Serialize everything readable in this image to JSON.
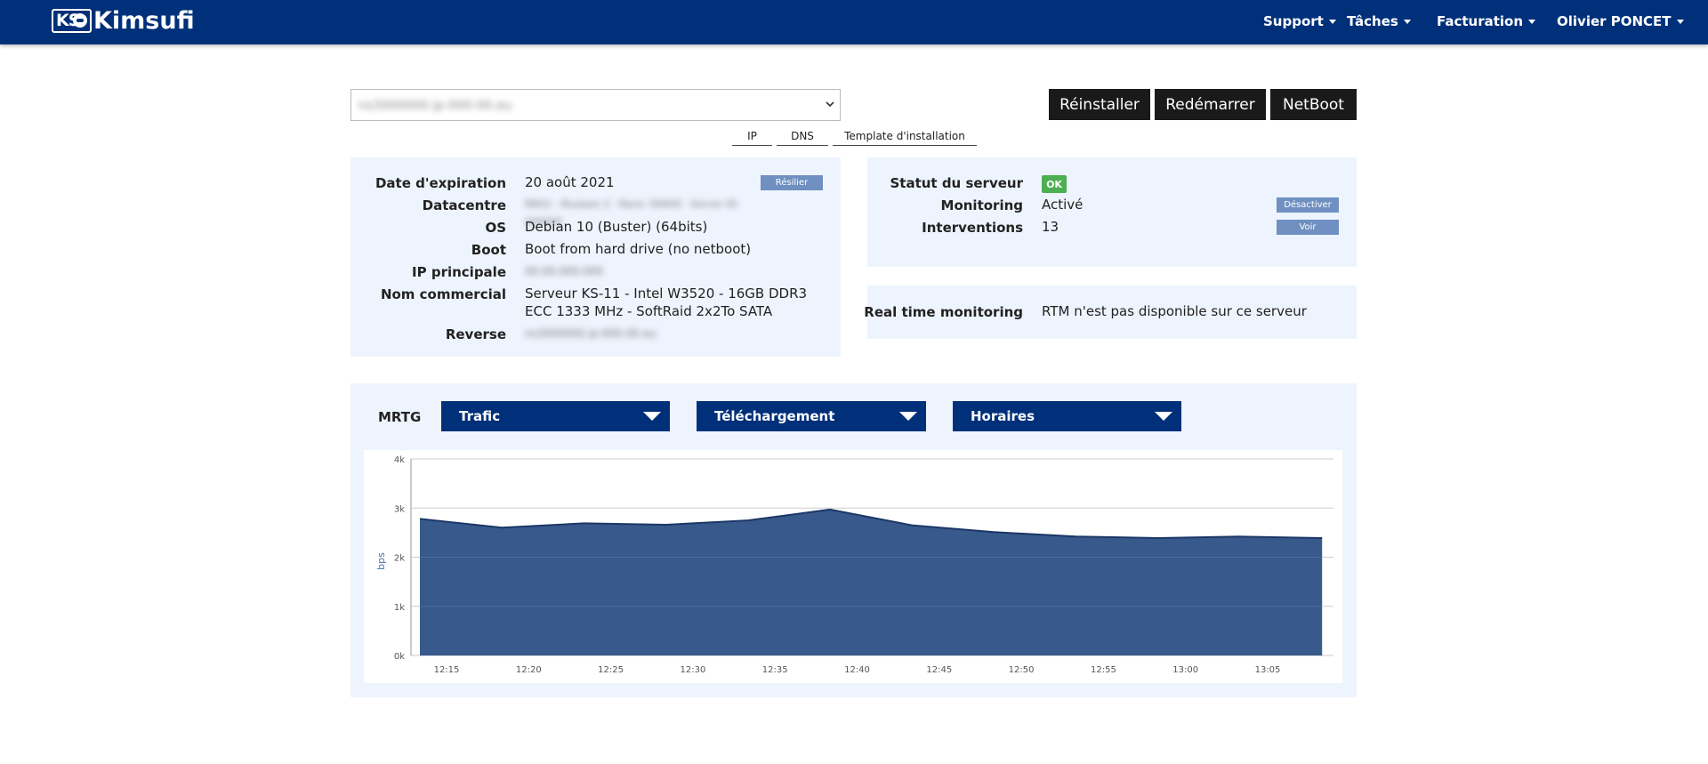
{
  "navbar": {
    "logo_mark": "KS",
    "logo_text": "Kimsufi",
    "menu": [
      {
        "label": "Support"
      },
      {
        "label": "Tâches"
      },
      {
        "label": "Facturation"
      },
      {
        "label": "Olivier PONCET"
      }
    ]
  },
  "server_select": {
    "value": "ns3000000.ip-000-00.eu",
    "chevron": "chevron-down-icon"
  },
  "actions": {
    "reinstall": "Réinstaller",
    "reboot": "Redémarrer",
    "netboot": "NetBoot"
  },
  "tabs": [
    "IP",
    "DNS",
    "Template d'installation"
  ],
  "details": {
    "expiration_label": "Date d'expiration",
    "expiration_value": "20 août 2021",
    "cancel_button": "Résilier",
    "datacenter_label": "Datacentre",
    "datacenter_value": "RBX2 - Roubaix 2 - Rack: 00A00 - Server ID: 000000",
    "os_label": "OS",
    "os_value": "Debian 10 (Buster) (64bits)",
    "boot_label": "Boot",
    "boot_value": "Boot from hard drive (no netboot)",
    "ip_label": "IP principale",
    "ip_value": "00.00.000.000",
    "name_label": "Nom commercial",
    "name_value": "Serveur KS-11 - Intel W3520 - 16GB DDR3 ECC 1333 MHz - SoftRaid 2x2To SATA",
    "reverse_label": "Reverse",
    "reverse_value": "ns3000000.ip-000-00.eu"
  },
  "status": {
    "server_status_label": "Statut du serveur",
    "server_status_value": "OK",
    "monitoring_label": "Monitoring",
    "monitoring_value": "Activé",
    "monitoring_button": "Désactiver",
    "interventions_label": "Interventions",
    "interventions_value": "13",
    "interventions_button": "Voir"
  },
  "rtm": {
    "label": "Real time monitoring",
    "value": "RTM n'est pas disponible sur ce serveur"
  },
  "mrtg": {
    "label": "MRTG",
    "dropdowns": [
      "Trafic",
      "Téléchargement",
      "Horaires"
    ]
  },
  "colors": {
    "navbar": "#00307a",
    "panel": "#eef4fd",
    "area": "#38598c",
    "ok": "#4caf50"
  },
  "chart_data": {
    "type": "area",
    "x": [
      "12:13",
      "12:18",
      "12:23",
      "12:28",
      "12:33",
      "12:38",
      "12:43",
      "12:48",
      "12:53",
      "12:58",
      "13:03",
      "13:08"
    ],
    "values": [
      2780,
      2600,
      2690,
      2660,
      2750,
      2970,
      2650,
      2510,
      2420,
      2390,
      2420,
      2390
    ],
    "xticks": [
      "12:15",
      "12:20",
      "12:25",
      "12:30",
      "12:35",
      "12:40",
      "12:45",
      "12:50",
      "12:55",
      "13:00",
      "13:05"
    ],
    "yticks": [
      "0k",
      "1k",
      "2k",
      "3k",
      "4k"
    ],
    "ylabel": "bps",
    "ylim": [
      0,
      4000
    ],
    "grid": true
  }
}
